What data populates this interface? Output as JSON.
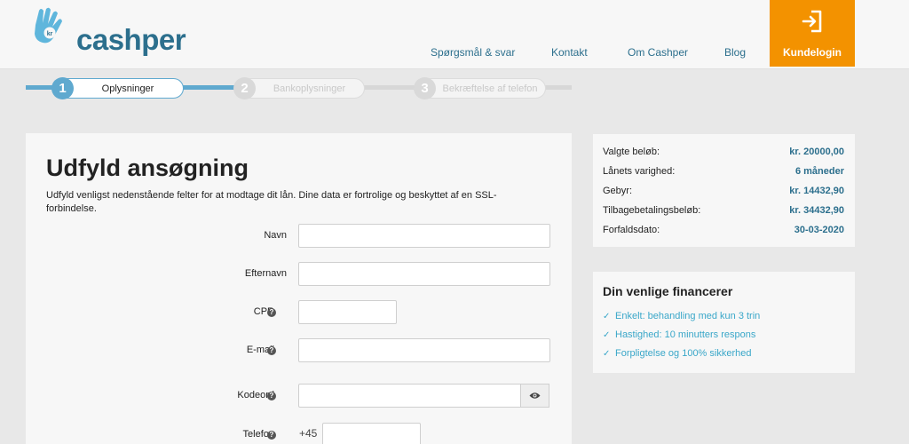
{
  "brand": {
    "name": "cashper",
    "accent": "#2c6f8d",
    "login_color": "#f39200",
    "link_color": "#3aa7c9"
  },
  "nav": {
    "items": [
      "Spørgsmål & svar",
      "Kontakt",
      "Om Cashper",
      "Blog"
    ],
    "login_label": "Kundelogin",
    "login_icon": "login-arrow-icon"
  },
  "steps": [
    {
      "num": "1",
      "label": "Oplysninger",
      "state": "active"
    },
    {
      "num": "2",
      "label": "Bankoplysninger",
      "state": "inactive"
    },
    {
      "num": "3",
      "label": "Bekræftelse af telefon",
      "state": "inactive"
    }
  ],
  "form": {
    "title": "Udfyld ansøgning",
    "intro": "Udfyld venligst nedenstående felter for at modtage dit lån. Dine data er fortrolige og beskyttet af en SSL-forbindelse.",
    "fields": {
      "navn": {
        "label": "Navn",
        "value": ""
      },
      "efternavn": {
        "label": "Efternavn",
        "value": ""
      },
      "cpr": {
        "label": "CPR",
        "value": ""
      },
      "email": {
        "label": "E-mail",
        "value": ""
      },
      "kodeord": {
        "label": "Kodeord",
        "value": ""
      },
      "telefon": {
        "label": "Telefon",
        "prefix": "+45",
        "value": ""
      }
    },
    "help_glyph": "?"
  },
  "summary": {
    "rows": [
      {
        "key": "Valgte beløb:",
        "value": "kr. 20000,00"
      },
      {
        "key": "Lånets varighed:",
        "value": "6 måneder"
      },
      {
        "key": "Gebyr:",
        "value": "kr. 14432,90"
      },
      {
        "key": "Tilbagebetalingsbeløb:",
        "value": "kr. 34432,90"
      },
      {
        "key": "Forfaldsdato:",
        "value": "30-03-2020"
      }
    ]
  },
  "financer": {
    "title": "Din venlige financerer",
    "items": [
      "Enkelt: behandling med kun 3 trin",
      "Hastighed: 10 minutters respons",
      "Forpligtelse og 100% sikkerhed"
    ]
  }
}
